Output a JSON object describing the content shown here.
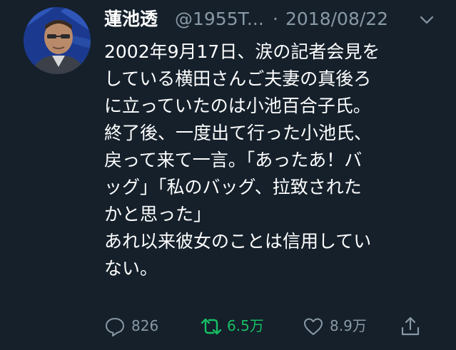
{
  "tweet": {
    "display_name": "蓮池透",
    "handle": "@1955T...",
    "separator": "·",
    "date": "2018/08/22",
    "menu_icon": "chevron-down-icon",
    "text_lines": [
      "2002年9月17日、涙の記者会見を",
      "している横田さんご夫妻の真後ろ",
      "に立っていたのは小池百合子氏。",
      "終了後、一度出て行った小池氏、",
      "戻って来て一言。「あったあ！バ",
      "ッグ」「私のバッグ、拉致された",
      "かと思った」",
      "あれ以来彼女のことは信用してい",
      "ない。"
    ]
  },
  "actions": {
    "reply": {
      "icon": "reply-icon",
      "count": "826"
    },
    "retweet": {
      "icon": "retweet-icon",
      "count": "6.5万",
      "color": "#17bf63"
    },
    "like": {
      "icon": "heart-icon",
      "count": "8.9万"
    },
    "share": {
      "icon": "share-icon"
    }
  },
  "colors": {
    "background": "#15202b",
    "text": "#ffffff",
    "secondary": "#8899a6",
    "retweet_active": "#17bf63"
  }
}
